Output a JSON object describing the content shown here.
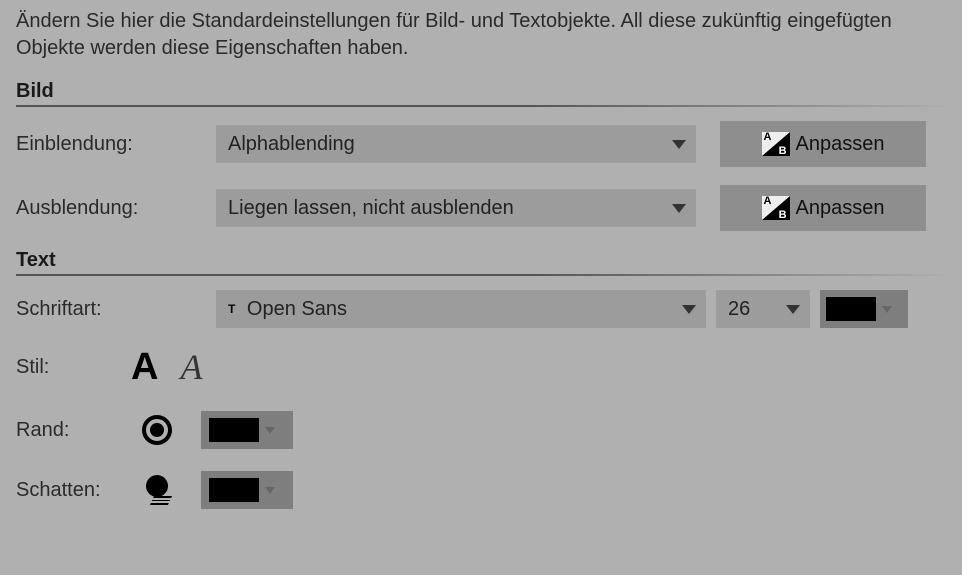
{
  "intro": "Ändern Sie hier die Standardeinstellungen für Bild- und Textobjekte. All diese zukünftig eingefügten Objekte werden diese Eigenschaften haben.",
  "sections": {
    "image": {
      "heading": "Bild",
      "fadeIn": {
        "label": "Einblendung:",
        "value": "Alphablending",
        "adjust": "Anpassen"
      },
      "fadeOut": {
        "label": "Ausblendung:",
        "value": "Liegen lassen, nicht ausblenden",
        "adjust": "Anpassen"
      }
    },
    "text": {
      "heading": "Text",
      "font": {
        "label": "Schriftart:",
        "value": "Open Sans",
        "size": "26",
        "color": "#000000"
      },
      "style": {
        "label": "Stil:"
      },
      "border": {
        "label": "Rand:",
        "color": "#000000"
      },
      "shadow": {
        "label": "Schatten:",
        "color": "#000000"
      }
    }
  }
}
